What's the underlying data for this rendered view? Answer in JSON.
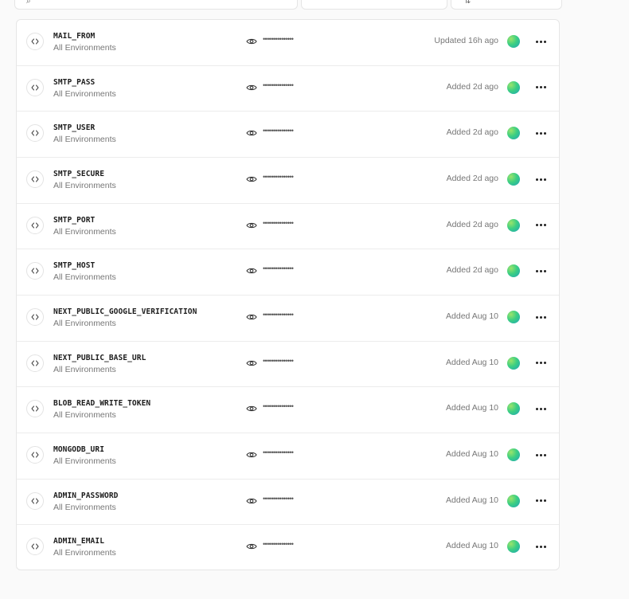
{
  "rows": [
    {
      "name": "MAIL_FROM",
      "env": "All Environments",
      "masked": "•••••••••••••••",
      "status": "Updated 16h ago"
    },
    {
      "name": "SMTP_PASS",
      "env": "All Environments",
      "masked": "•••••••••••••••",
      "status": "Added 2d ago"
    },
    {
      "name": "SMTP_USER",
      "env": "All Environments",
      "masked": "•••••••••••••••",
      "status": "Added 2d ago"
    },
    {
      "name": "SMTP_SECURE",
      "env": "All Environments",
      "masked": "•••••••••••••••",
      "status": "Added 2d ago"
    },
    {
      "name": "SMTP_PORT",
      "env": "All Environments",
      "masked": "•••••••••••••••",
      "status": "Added 2d ago"
    },
    {
      "name": "SMTP_HOST",
      "env": "All Environments",
      "masked": "•••••••••••••••",
      "status": "Added 2d ago"
    },
    {
      "name": "NEXT_PUBLIC_GOOGLE_VERIFICATION",
      "env": "All Environments",
      "masked": "•••••••••••••••",
      "status": "Added Aug 10"
    },
    {
      "name": "NEXT_PUBLIC_BASE_URL",
      "env": "All Environments",
      "masked": "•••••••••••••••",
      "status": "Added Aug 10"
    },
    {
      "name": "BLOB_READ_WRITE_TOKEN",
      "env": "All Environments",
      "masked": "•••••••••••••••",
      "status": "Added Aug 10"
    },
    {
      "name": "MONGODB_URI",
      "env": "All Environments",
      "masked": "•••••••••••••••",
      "status": "Added Aug 10"
    },
    {
      "name": "ADMIN_PASSWORD",
      "env": "All Environments",
      "masked": "•••••••••••••••",
      "status": "Added Aug 10"
    },
    {
      "name": "ADMIN_EMAIL",
      "env": "All Environments",
      "masked": "•••••••••••••••",
      "status": "Added Aug 10"
    }
  ],
  "icons": {
    "row_type": "code-brackets-icon",
    "reveal": "eye-icon",
    "actions": "more-horizontal-icon",
    "avatar": "user-avatar"
  },
  "colors": {
    "avatar_gradient": [
      "#9be36b",
      "#3ccf82",
      "#1fa5b8"
    ],
    "border": "#ececec",
    "muted_text": "#777777"
  }
}
